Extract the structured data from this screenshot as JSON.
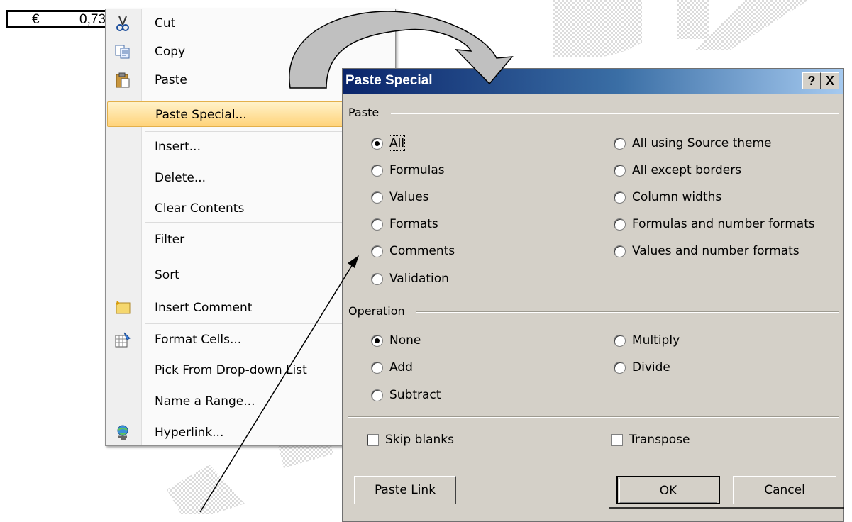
{
  "cell": {
    "currency": "€",
    "value": "0,73"
  },
  "context_menu": {
    "items": [
      {
        "label": "Cut",
        "icon": "scissors-icon"
      },
      {
        "label": "Copy",
        "icon": "copy-icon"
      },
      {
        "label": "Paste",
        "icon": "clipboard-icon"
      },
      {
        "label": "Paste Special...",
        "icon": ""
      },
      {
        "label": "Insert...",
        "icon": ""
      },
      {
        "label": "Delete...",
        "icon": ""
      },
      {
        "label": "Clear Contents",
        "icon": ""
      },
      {
        "label": "Filter",
        "icon": ""
      },
      {
        "label": "Sort",
        "icon": ""
      },
      {
        "label": "Insert Comment",
        "icon": "comment-icon"
      },
      {
        "label": "Format Cells...",
        "icon": "format-cells-icon"
      },
      {
        "label": "Pick From Drop-down List",
        "icon": ""
      },
      {
        "label": "Name a Range...",
        "icon": ""
      },
      {
        "label": "Hyperlink...",
        "icon": "hyperlink-icon"
      }
    ],
    "highlighted_index": 3
  },
  "dialog": {
    "title": "Paste Special",
    "help_button": "?",
    "close_button": "X",
    "paste_group": {
      "label": "Paste",
      "options": [
        {
          "label": "All",
          "selected": true
        },
        {
          "label": "Formulas",
          "selected": false
        },
        {
          "label": "Values",
          "selected": false
        },
        {
          "label": "Formats",
          "selected": false
        },
        {
          "label": "Comments",
          "selected": false
        },
        {
          "label": "Validation",
          "selected": false
        },
        {
          "label": "All using Source theme",
          "selected": false
        },
        {
          "label": "All except borders",
          "selected": false
        },
        {
          "label": "Column widths",
          "selected": false
        },
        {
          "label": "Formulas and number formats",
          "selected": false
        },
        {
          "label": "Values and number formats",
          "selected": false
        }
      ]
    },
    "operation_group": {
      "label": "Operation",
      "options": [
        {
          "label": "None",
          "selected": true
        },
        {
          "label": "Add",
          "selected": false
        },
        {
          "label": "Subtract",
          "selected": false
        },
        {
          "label": "Multiply",
          "selected": false
        },
        {
          "label": "Divide",
          "selected": false
        }
      ]
    },
    "skip_blanks": {
      "label": "Skip blanks",
      "checked": false
    },
    "transpose": {
      "label": "Transpose",
      "checked": false
    },
    "buttons": {
      "paste_link": "Paste Link",
      "ok": "OK",
      "cancel": "Cancel"
    }
  },
  "colors": {
    "title_bar": "#0a246a",
    "dialog_bg": "#d4d0c8",
    "highlight": "#ffd37a",
    "arrow_fill": "#c0c0c0"
  }
}
